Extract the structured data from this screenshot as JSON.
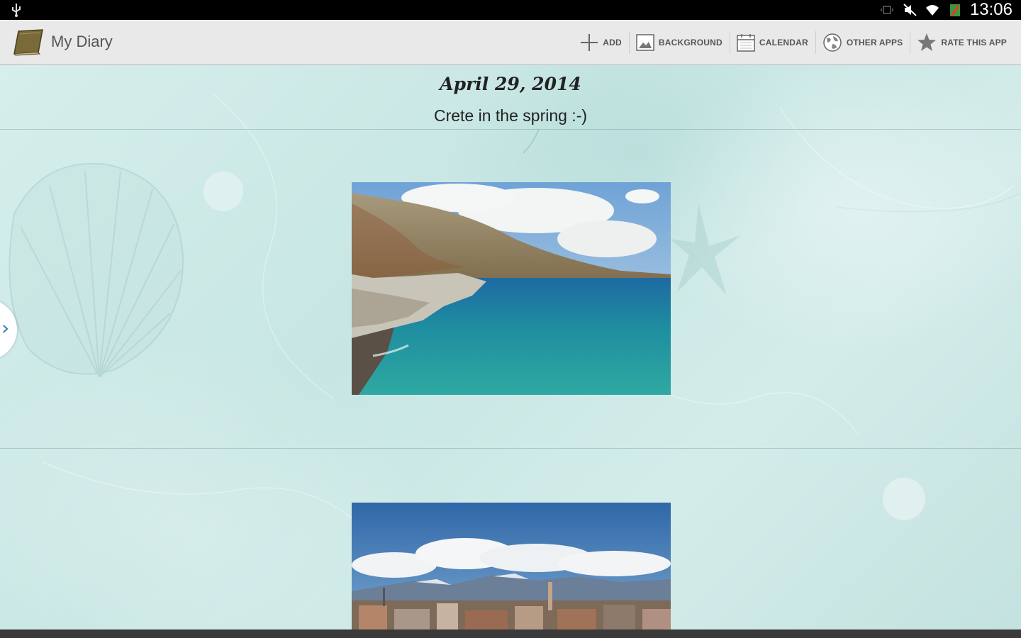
{
  "status_bar": {
    "time": "13:06"
  },
  "action_bar": {
    "title": "My Diary",
    "actions": [
      {
        "id": "add",
        "label": "ADD",
        "icon": "plus-icon"
      },
      {
        "id": "background",
        "label": "BACKGROUND",
        "icon": "image-icon"
      },
      {
        "id": "calendar",
        "label": "CALENDAR",
        "icon": "calendar-icon"
      },
      {
        "id": "other_apps",
        "label": "OTHER APPS",
        "icon": "globe-icon"
      },
      {
        "id": "rate",
        "label": "RATE THIS APP",
        "icon": "star-icon"
      }
    ]
  },
  "entry": {
    "date": "April 29, 2014",
    "text": "Crete in the spring :-)"
  },
  "drawer": {
    "icon": "chevron-right-icon",
    "glyph": "›"
  }
}
